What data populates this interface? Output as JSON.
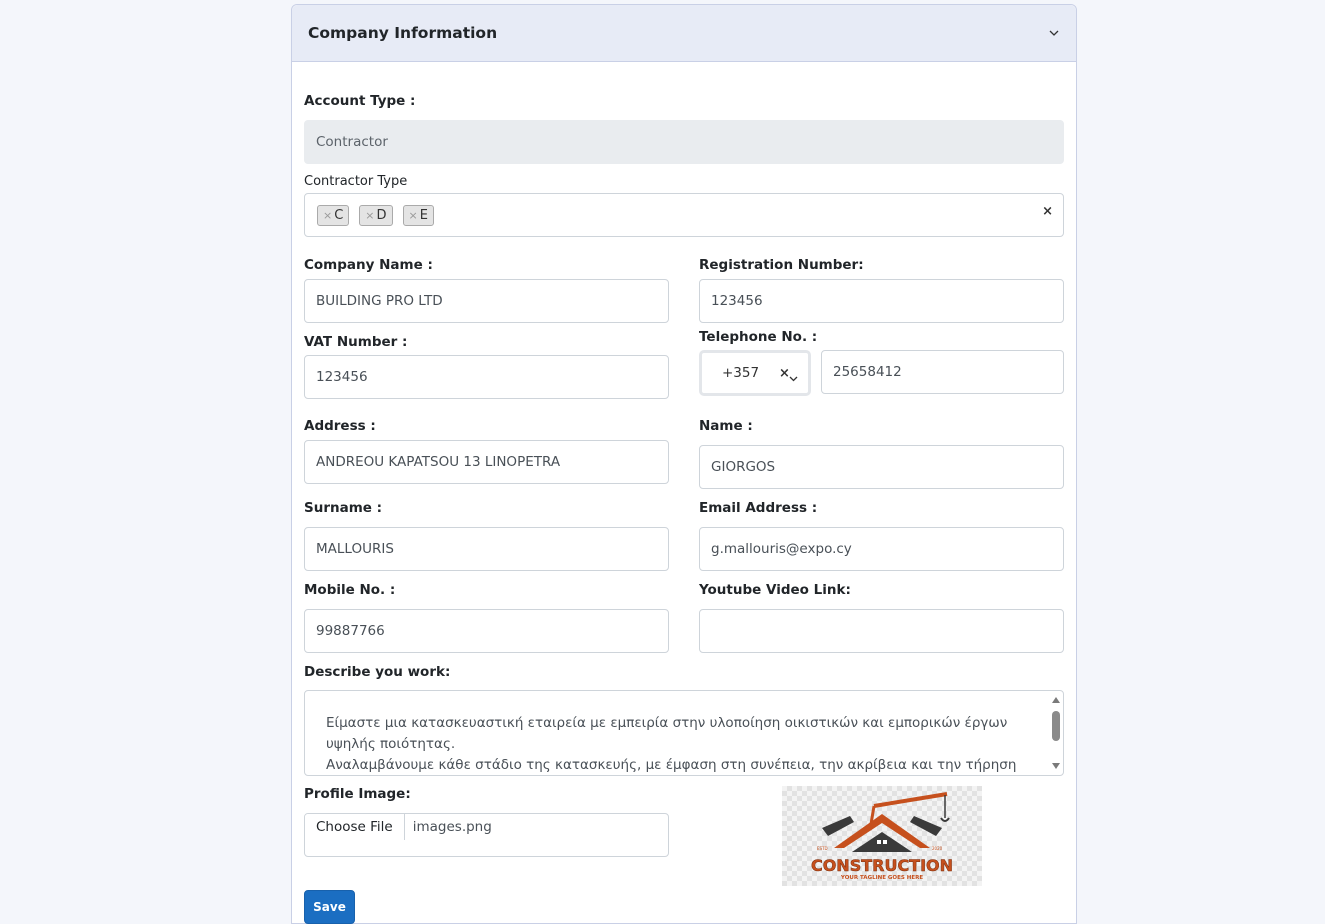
{
  "section": {
    "title": "Company Information"
  },
  "account_type": {
    "label": "Account Type :",
    "value": "Contractor"
  },
  "contractor_type": {
    "label": "Contractor Type",
    "tags": [
      "C",
      "D",
      "E"
    ],
    "clear": "×",
    "tag_remove": "×"
  },
  "company_name": {
    "label": "Company Name :",
    "value": "BUILDING PRO LTD"
  },
  "registration_number": {
    "label": "Registration Number:",
    "value": "123456"
  },
  "vat_number": {
    "label": "VAT Number :",
    "value": "123456"
  },
  "telephone": {
    "label": "Telephone No. :",
    "country_code": "+357",
    "clear": "×",
    "value": "25658412"
  },
  "address": {
    "label": "Address :",
    "value": "ANDREOU KAPATSOU 13 LINOPETRA"
  },
  "name": {
    "label": "Name :",
    "value": "GIORGOS"
  },
  "surname": {
    "label": "Surname :",
    "value": "MALLOURIS"
  },
  "email": {
    "label": "Email Address :",
    "value": "g.mallouris@expo.cy"
  },
  "mobile": {
    "label": "Mobile No. :",
    "value": "99887766"
  },
  "youtube": {
    "label": "Youtube Video Link:",
    "value": ""
  },
  "description": {
    "label": "Describe you work:",
    "lines": [
      "Είμαστε μια κατασκευαστική εταιρεία με εμπειρία στην υλοποίηση οικιστικών και εμπορικών έργων",
      "υψηλής ποιότητας.",
      "Αναλαμβάνουμε κάθε στάδιο της κατασκευής, με έμφαση στη συνέπεια, την ακρίβεια και την τήρηση"
    ]
  },
  "profile_image": {
    "label": "Profile Image:",
    "button": "Choose File",
    "file_name": "images.png",
    "logo": {
      "title": "CONSTRUCTION",
      "tagline": "YOUR TAGLINE GOES HERE",
      "estd": "ESTD",
      "year": "2020"
    }
  },
  "actions": {
    "save": "Save"
  },
  "colors": {
    "primary": "#1b6ec2",
    "header_bg": "#e7ebf6",
    "logo_orange": "#c6501d",
    "logo_dark": "#3a3a3a"
  }
}
